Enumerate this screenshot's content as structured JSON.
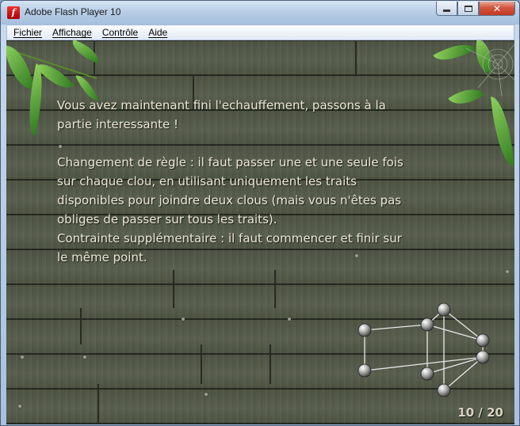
{
  "window": {
    "title": "Adobe Flash Player 10",
    "app_icon": "flash-player-icon"
  },
  "controls": {
    "close_label": "✕"
  },
  "menu": {
    "items": [
      "Fichier",
      "Affichage",
      "Contrôle",
      "Aide"
    ]
  },
  "game": {
    "message": "Vous avez maintenant fini l'echauffement, passons à la\npartie interessante !\n\nChangement de règle : il faut passer une et une seule fois\nsur chaque clou, en utilisant uniquement les traits\ndisponibles pour joindre deux clous (mais vous n'êtes pas\nobliges de passer sur tous les traits).\nContrainte supplémentaire : il faut commencer et finir sur\nle même point.",
    "page_counter": "10 / 20",
    "colors": {
      "text": "#ece7d4",
      "wood": "#4f5546",
      "line": "#e8e8e8"
    },
    "puzzle": {
      "nodes": 7,
      "edges": [
        [
          0,
          1
        ],
        [
          0,
          2
        ],
        [
          1,
          3
        ],
        [
          2,
          3
        ],
        [
          2,
          4
        ],
        [
          3,
          5
        ],
        [
          4,
          6
        ],
        [
          5,
          6
        ],
        [
          3,
          6
        ],
        [
          1,
          4
        ]
      ]
    }
  }
}
